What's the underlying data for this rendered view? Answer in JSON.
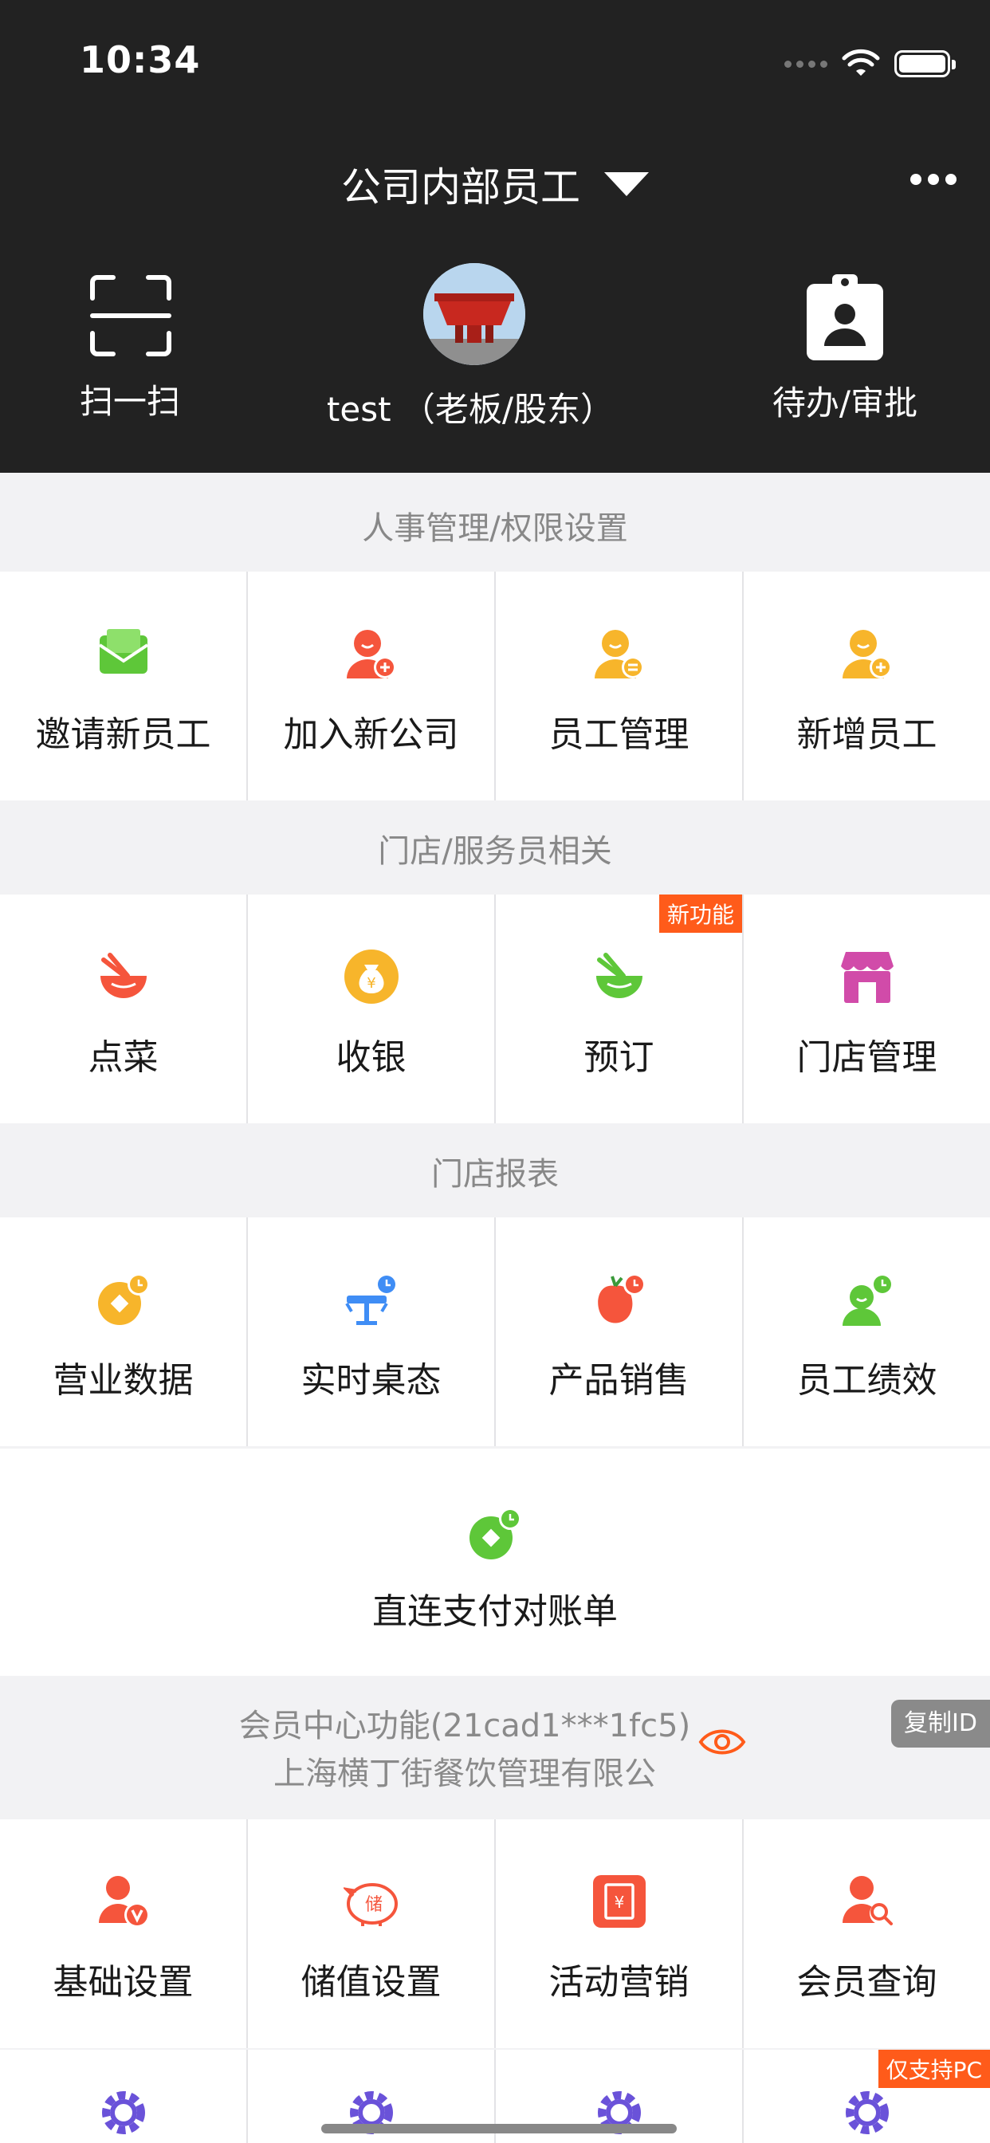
{
  "status_bar": {
    "time": "10:34"
  },
  "header": {
    "company": "公司内部员工",
    "scan_label": "扫一扫",
    "user_label": "test （老板/股东）",
    "todo_label": "待办/审批"
  },
  "sections": {
    "hr": {
      "title": "人事管理/权限设置",
      "items": [
        {
          "label": "邀请新员工",
          "icon": "invite-envelope-icon"
        },
        {
          "label": "加入新公司",
          "icon": "join-company-icon"
        },
        {
          "label": "员工管理",
          "icon": "staff-manage-icon"
        },
        {
          "label": "新增员工",
          "icon": "add-staff-icon"
        }
      ]
    },
    "store": {
      "title": "门店/服务员相关",
      "items": [
        {
          "label": "点菜",
          "icon": "order-bowl-icon"
        },
        {
          "label": "收银",
          "icon": "cashier-moneybag-icon"
        },
        {
          "label": "预订",
          "icon": "reserve-bowl-icon",
          "badge": "新功能"
        },
        {
          "label": "门店管理",
          "icon": "storefront-icon"
        }
      ]
    },
    "reports": {
      "title": "门店报表",
      "items": [
        {
          "label": "营业数据",
          "icon": "business-data-icon"
        },
        {
          "label": "实时桌态",
          "icon": "table-status-icon"
        },
        {
          "label": "产品销售",
          "icon": "product-sales-icon"
        },
        {
          "label": "员工绩效",
          "icon": "staff-performance-icon"
        }
      ],
      "wide_item": {
        "label": "直连支付对账单",
        "icon": "payment-statement-icon"
      }
    },
    "member": {
      "line1": "会员中心功能(21cad1***1fc5)",
      "line2": "上海横丁街餐饮管理有限公",
      "copy_id": "复制ID",
      "items": [
        {
          "label": "基础设置",
          "icon": "basic-settings-icon"
        },
        {
          "label": "储值设置",
          "icon": "stored-value-icon"
        },
        {
          "label": "活动营销",
          "icon": "marketing-ticket-icon"
        },
        {
          "label": "会员查询",
          "icon": "member-search-icon"
        }
      ],
      "pc_badge": "仅支持PC"
    }
  },
  "colors": {
    "header_bg": "#222222",
    "page_bg": "#f2f2f4",
    "accent_orange": "#ff5b1a",
    "icon_red": "#f5553c",
    "icon_yellow": "#f7b52b",
    "icon_green": "#5ec739",
    "icon_blue": "#3f8df5",
    "icon_pink": "#d14ba9",
    "icon_purple": "#6a52d9"
  }
}
